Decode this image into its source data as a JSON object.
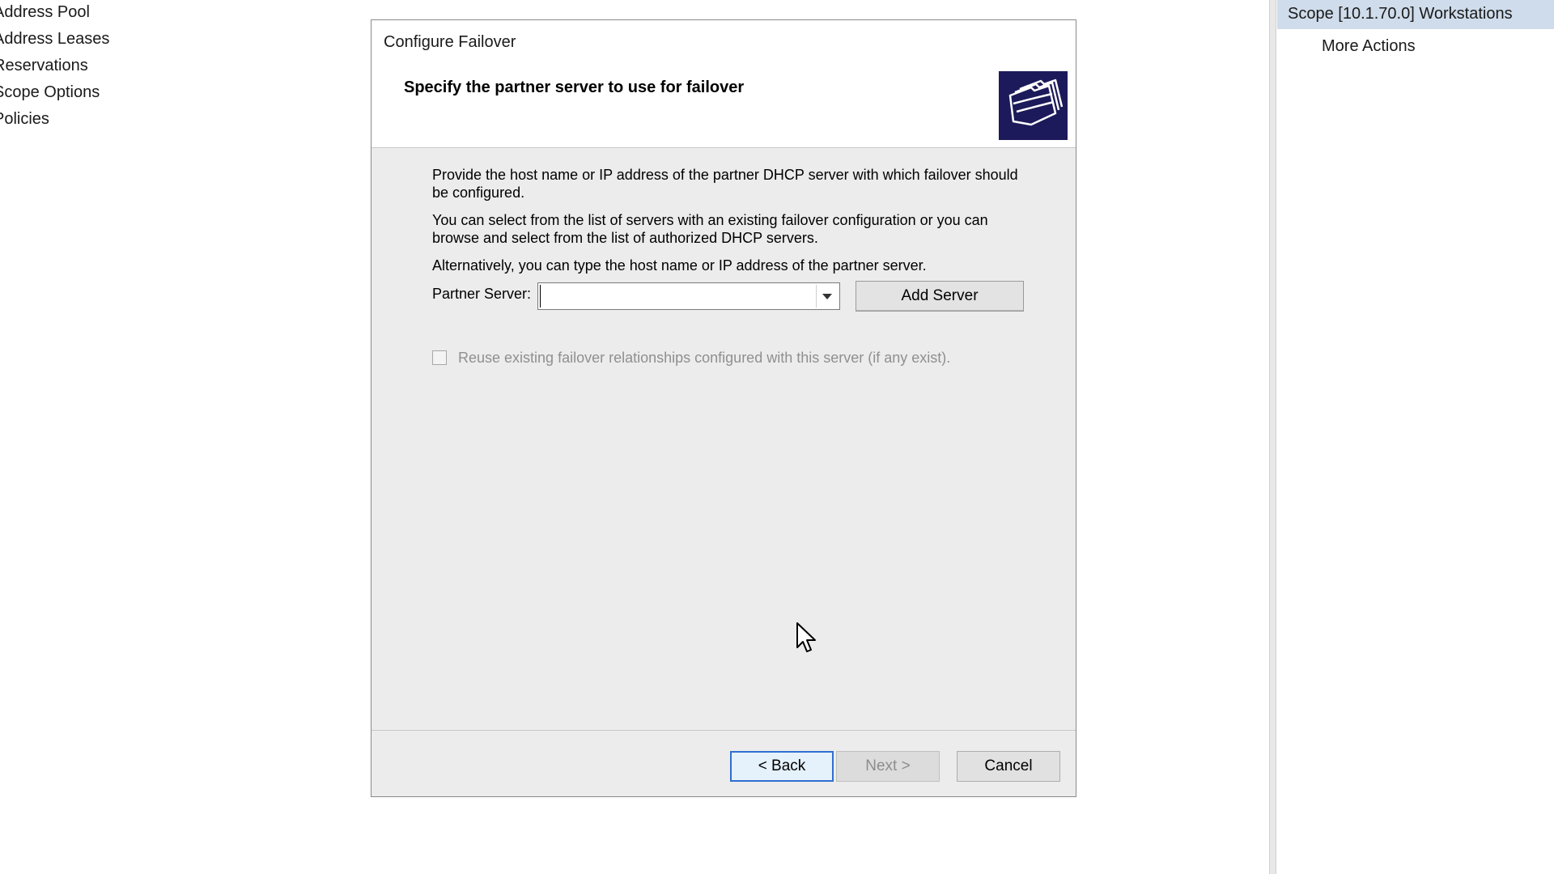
{
  "left_tree": {
    "items": [
      {
        "label": "Address Pool"
      },
      {
        "label": "Address Leases"
      },
      {
        "label": "Reservations"
      },
      {
        "label": "Scope Options"
      },
      {
        "label": "Policies"
      }
    ]
  },
  "actions_pane": {
    "header": "Scope [10.1.70.0] Workstations",
    "items": [
      {
        "label": "More Actions"
      }
    ]
  },
  "dialog": {
    "title": "Configure Failover",
    "heading": "Specify the partner server to use for failover",
    "icon": "failover-folders-icon",
    "paragraphs": [
      "Provide the host name or IP address of the partner DHCP server with which failover should be configured.",
      "You can select from the list of servers with an existing failover configuration or you can browse and select from the list of authorized DHCP servers.",
      "Alternatively, you can type the host name or IP address of the partner server."
    ],
    "partner_server": {
      "label": "Partner Server:",
      "value": "",
      "add_button": "Add Server"
    },
    "reuse_checkbox": {
      "label": "Reuse existing failover relationships configured with this server (if any exist).",
      "checked": false,
      "enabled": false
    },
    "buttons": {
      "back": "< Back",
      "next": "Next >",
      "cancel": "Cancel"
    }
  },
  "colors": {
    "actions_header_bg": "#cfdceb",
    "dialog_bg": "#ececec",
    "icon_bg": "#1c1a5a",
    "focus_blue": "#2e6fd0"
  }
}
